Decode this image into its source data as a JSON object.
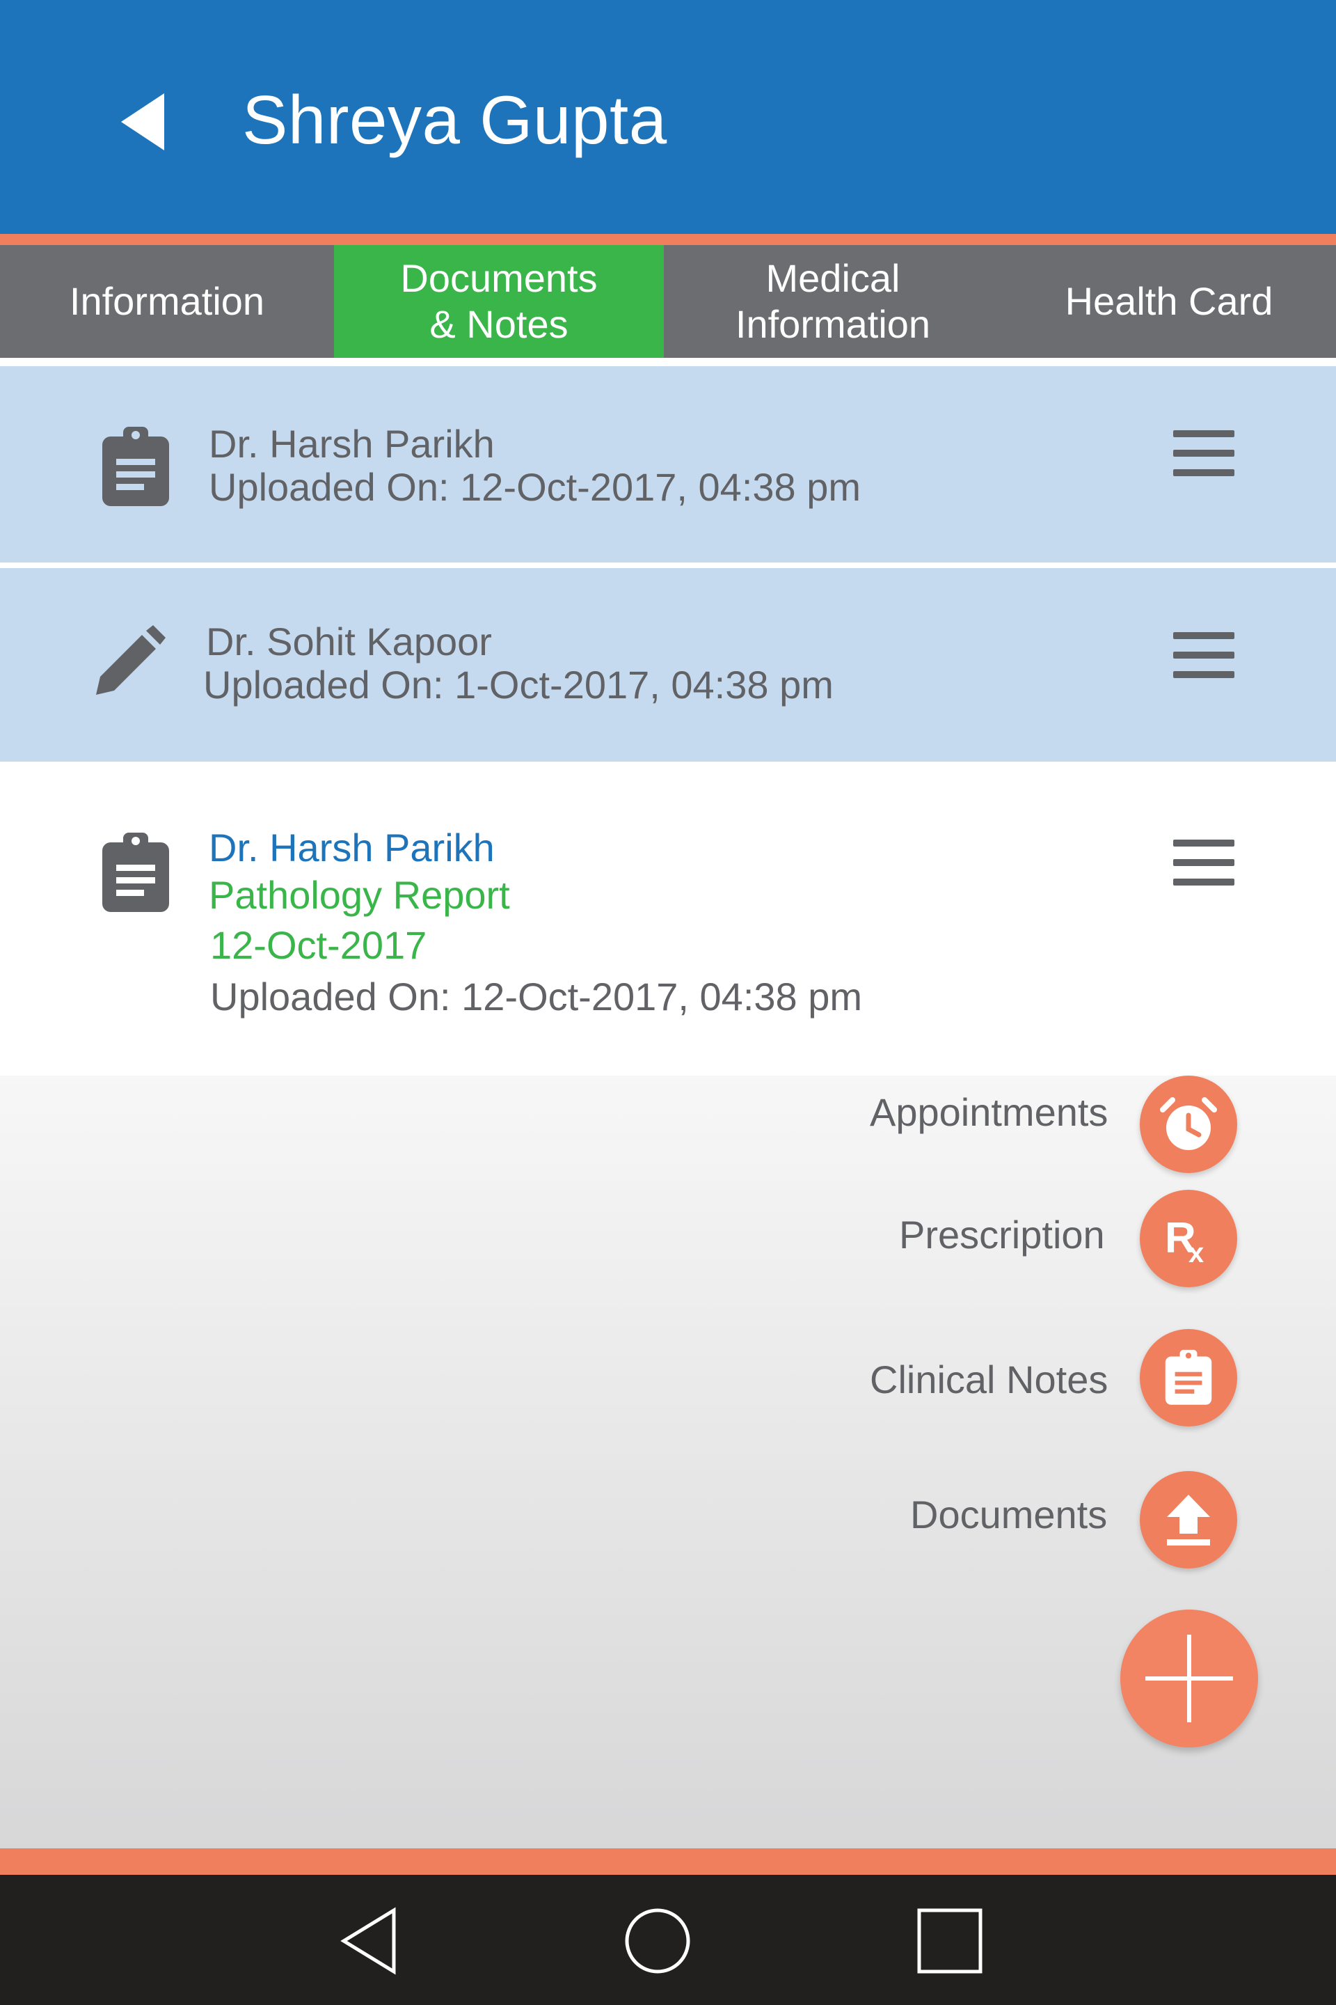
{
  "header": {
    "title": "Shreya Gupta",
    "back_icon": "back-arrow-icon",
    "background": "#1e74ba",
    "accent": "#f07f5e"
  },
  "tabs": [
    {
      "label_line1": "Information",
      "label_line2": "",
      "active": false
    },
    {
      "label_line1": "Documents",
      "label_line2": "& Notes",
      "active": true
    },
    {
      "label_line1": "Medical",
      "label_line2": "Information",
      "active": false
    },
    {
      "label_line1": "Health Card",
      "label_line2": "",
      "active": false
    }
  ],
  "tab_colors": {
    "inactive": "#6c6d70",
    "active": "#3ab54a"
  },
  "records": [
    {
      "icon": "clipboard-icon",
      "doctor": "Dr. Harsh Parikh",
      "uploaded": "Uploaded On: 12-Oct-2017, 04:38 pm"
    },
    {
      "icon": "pencil-icon",
      "doctor": "Dr. Sohit Kapoor",
      "uploaded": "Uploaded On: 1-Oct-2017, 04:38 pm"
    },
    {
      "icon": "clipboard-icon",
      "doctor": "Dr. Harsh Parikh",
      "type": "Pathology Report",
      "date": "12-Oct-2017",
      "uploaded": "Uploaded On: 12-Oct-2017, 04:38 pm"
    }
  ],
  "fab_menu": [
    {
      "label": "Appointments",
      "icon": "alarm-clock-icon"
    },
    {
      "label": "Prescription",
      "icon": "rx-icon"
    },
    {
      "label": "Clinical Notes",
      "icon": "clipboard-icon"
    },
    {
      "label": "Documents",
      "icon": "upload-icon"
    }
  ],
  "fab_main_icon": "plus-icon",
  "nav": [
    "nav-back-icon",
    "nav-home-icon",
    "nav-recents-icon"
  ]
}
